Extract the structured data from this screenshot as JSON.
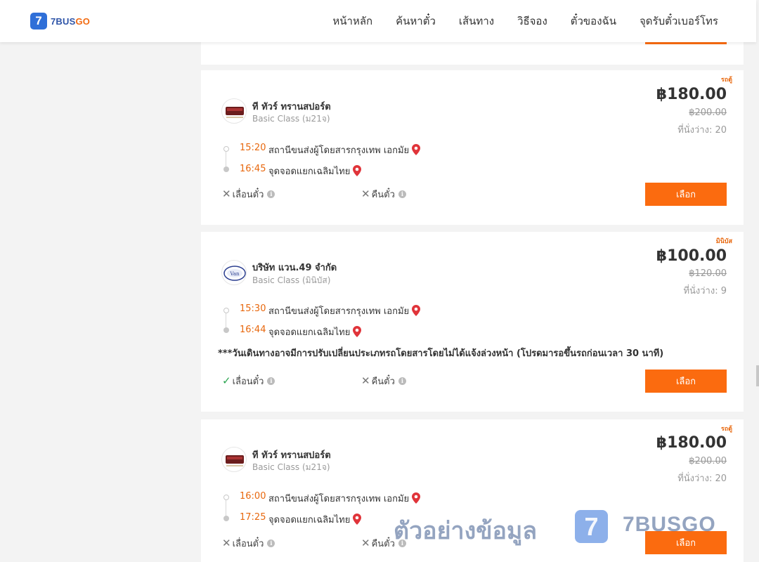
{
  "app": {
    "logo_mark": "7",
    "logo_text_main": "7BUS",
    "logo_text_accent": "GO",
    "brand_color": "#2f6fd8",
    "accent_color": "#fb6b0f"
  },
  "nav": {
    "items": [
      "หน้าหลัก",
      "ค้นหาตั๋ว",
      "เส้นทาง",
      "วิธีจอง",
      "ตั๋วของฉัน",
      "จุดรับตั๋วเบอร์โทร"
    ]
  },
  "trips": [
    {
      "vehicle_type": "รถตู้",
      "operator": "ที ทัวร์ ทรานสปอร์ต",
      "class": "Basic Class (ม21จ)",
      "price": "฿180.00",
      "old_price": "฿200.00",
      "seats": "ที่นั่งว่าง: 20",
      "depart_time": "15:20",
      "depart_stop": "สถานีขนส่งผู้โดยสารกรุงเทพ เอกมัย",
      "arrive_time": "16:45",
      "arrive_stop": "จุดจอดแยกเฉลิมไทย",
      "change_seat": "เลื่อนตั๋ว",
      "change_allowed": false,
      "refund": "คืนตั๋ว",
      "refund_allowed": false,
      "select_label": "เลือก"
    },
    {
      "vehicle_type": "มินิบัส",
      "operator": "บริษัท แวน.49 จำกัด",
      "class": "Basic Class (มินิบัส)",
      "price": "฿100.00",
      "old_price": "฿120.00",
      "seats": "ที่นั่งว่าง: 9",
      "depart_time": "15:30",
      "depart_stop": "สถานีขนส่งผู้โดยสารกรุงเทพ เอกมัย",
      "arrive_time": "16:44",
      "arrive_stop": "จุดจอดแยกเฉลิมไทย",
      "notice": "***วันเดินทางอาจมีการปรับเปลี่ยนประเภทรถโดยสารโดยไม่ได้แจ้งล่วงหน้า (โปรดมารอขึ้นรถก่อนเวลา 30 นาที)",
      "change_seat": "เลื่อนตั๋ว",
      "change_allowed": true,
      "refund": "คืนตั๋ว",
      "refund_allowed": false,
      "select_label": "เลือก"
    },
    {
      "vehicle_type": "รถตู้",
      "operator": "ที ทัวร์ ทรานสปอร์ต",
      "class": "Basic Class (ม21จ)",
      "price": "฿180.00",
      "old_price": "฿200.00",
      "seats": "ที่นั่งว่าง: 20",
      "depart_time": "16:00",
      "depart_stop": "สถานีขนส่งผู้โดยสารกรุงเทพ เอกมัย",
      "arrive_time": "17:25",
      "arrive_stop": "จุดจอดแยกเฉลิมไทย",
      "change_seat": "เลื่อนตั๋ว",
      "change_allowed": false,
      "refund": "คืนตั๋ว",
      "refund_allowed": false,
      "select_label": "เลือก"
    }
  ],
  "watermark": {
    "text": "ตัวอย่างข้อมูล",
    "logo_mark": "7",
    "brand": "7BUSGO"
  },
  "icons": {
    "pin": "map-pin-icon",
    "cross": "cross-icon",
    "check": "check-icon",
    "info": "info-icon"
  }
}
